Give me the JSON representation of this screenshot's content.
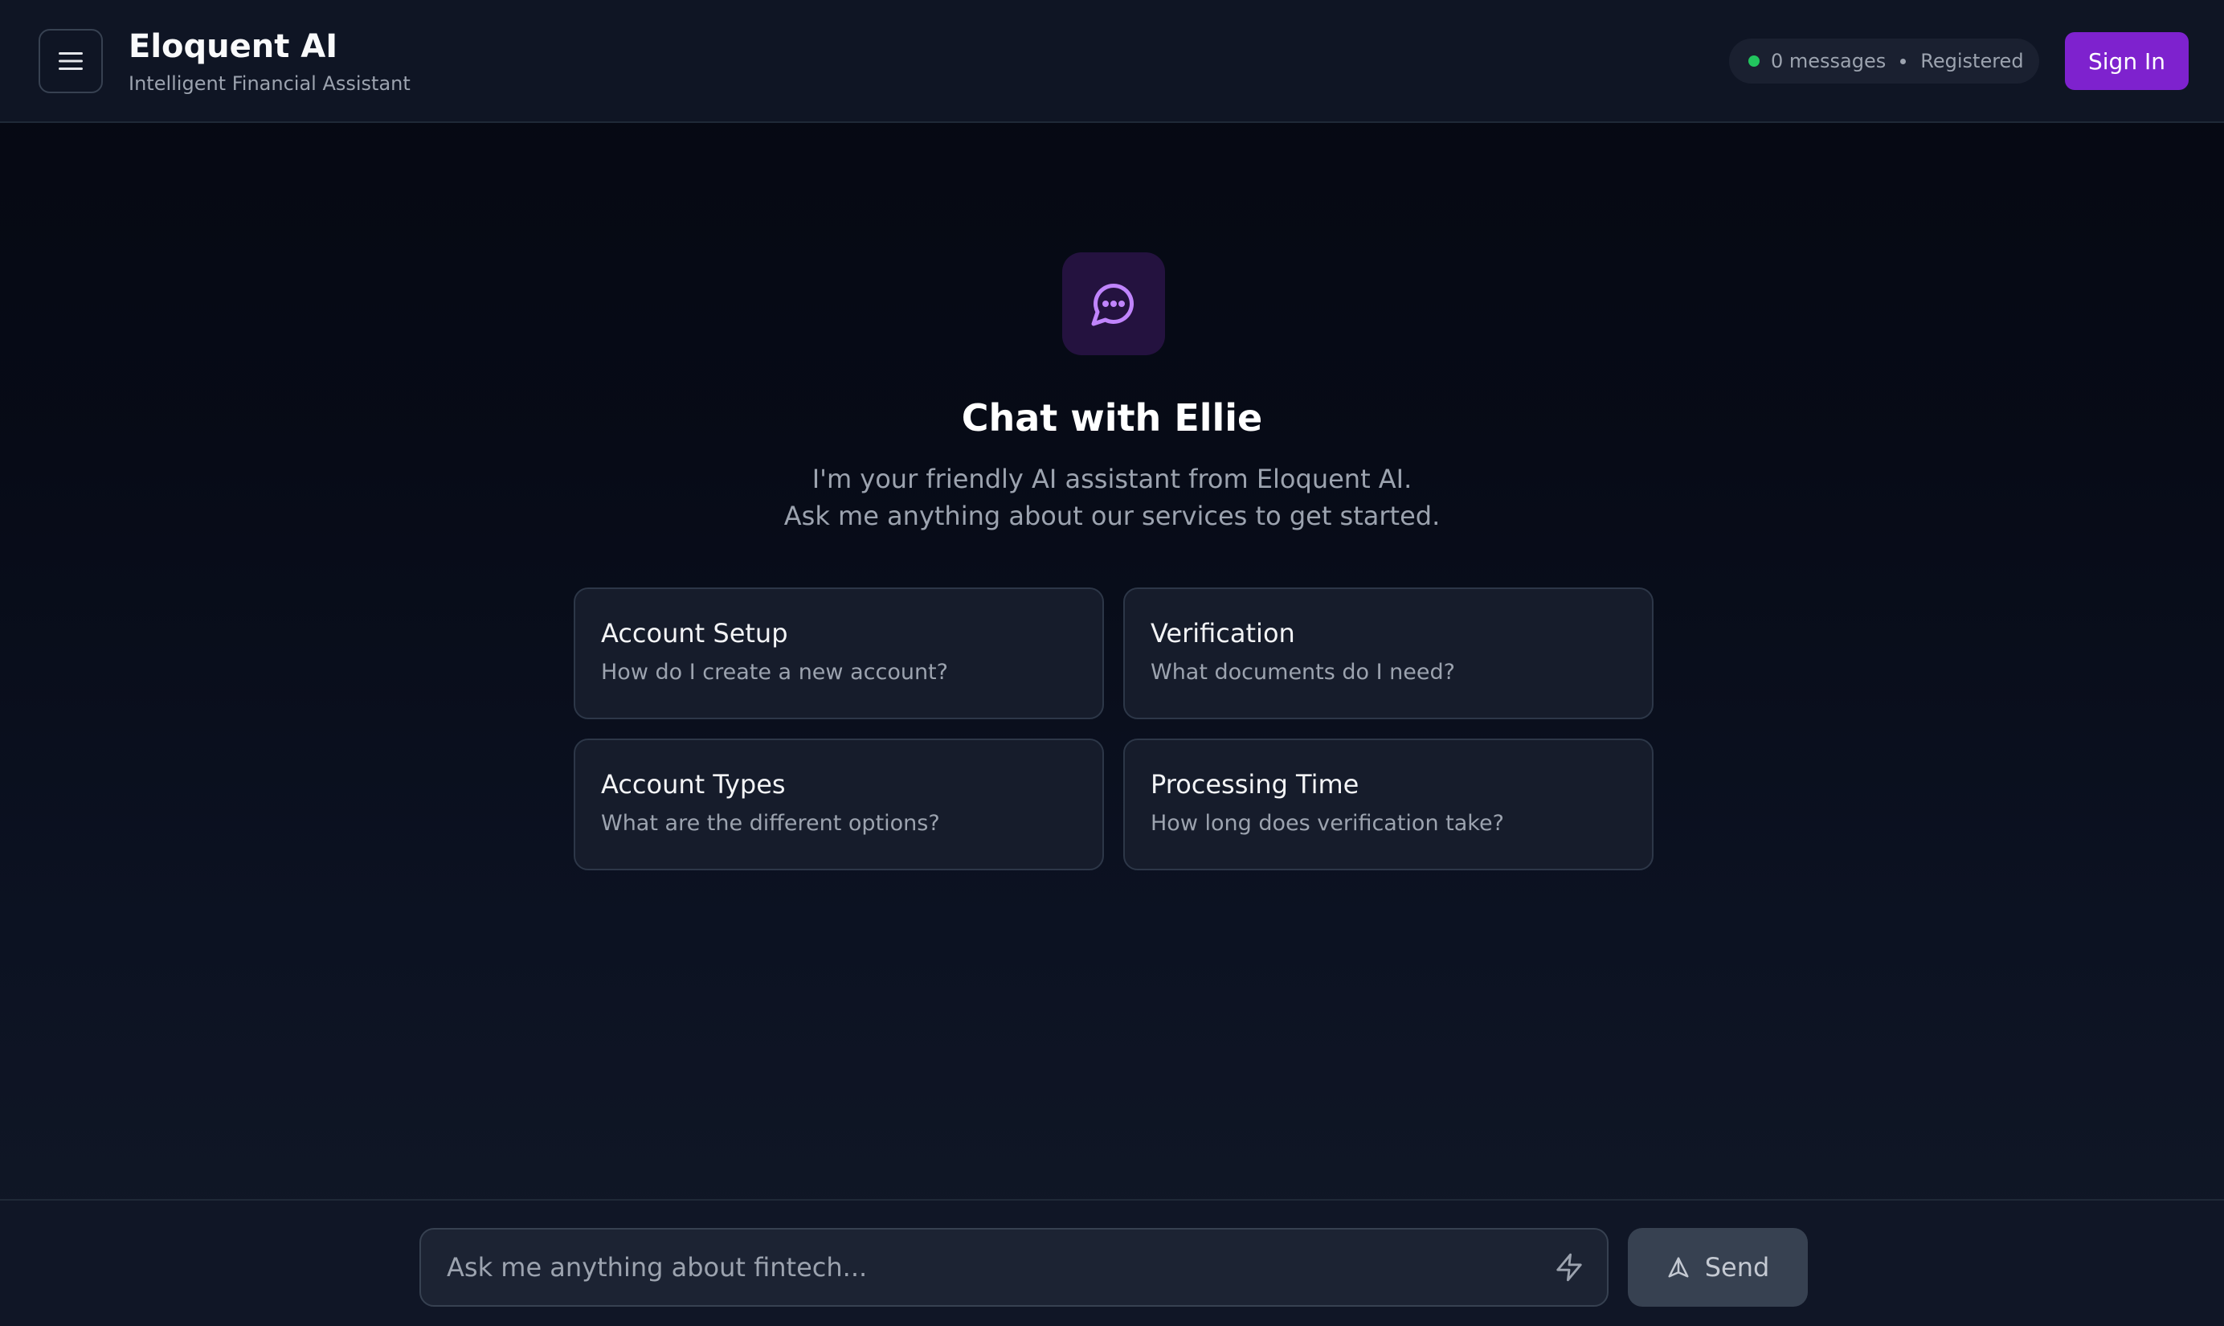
{
  "header": {
    "menu_icon": "hamburger-menu-icon",
    "title": "Eloquent AI",
    "subtitle": "Intelligent Financial Assistant",
    "status": {
      "messages": "0 messages",
      "state": "Registered",
      "dot_color": "#22c55e"
    },
    "sign_in_label": "Sign In",
    "accent_color": "#7e22ce"
  },
  "hero": {
    "icon": "chat-bubble-icon",
    "title": "Chat with Ellie",
    "line1": "I'm your friendly AI assistant from Eloquent AI.",
    "line2": "Ask me anything about our services to get started."
  },
  "suggestions": [
    {
      "title": "Account Setup",
      "description": "How do I create a new account?"
    },
    {
      "title": "Verification",
      "description": "What documents do I need?"
    },
    {
      "title": "Account Types",
      "description": "What are the different options?"
    },
    {
      "title": "Processing Time",
      "description": "How long does verification take?"
    }
  ],
  "composer": {
    "placeholder": "Ask me anything about fintech...",
    "quick_icon": "lightning-bolt-icon",
    "send_label": "Send",
    "send_icon": "send-arrow-icon"
  }
}
